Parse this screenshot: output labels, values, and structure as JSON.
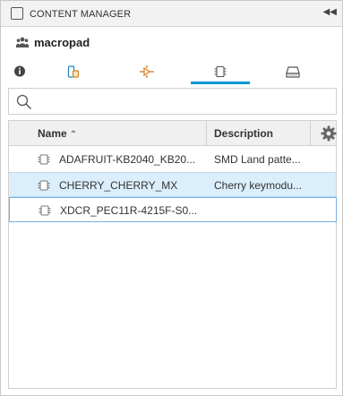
{
  "panel": {
    "title": "CONTENT MANAGER",
    "collapse_icon": "double-chevron-left-icon"
  },
  "project": {
    "name": "macropad",
    "icon": "people-group-icon"
  },
  "tabs": [
    {
      "icon": "info-icon",
      "active": false
    },
    {
      "icon": "component-icon",
      "active": false
    },
    {
      "icon": "symbol-icon",
      "active": false
    },
    {
      "icon": "footprint-icon",
      "active": true
    },
    {
      "icon": "3d-package-icon",
      "active": false
    }
  ],
  "search": {
    "value": "",
    "placeholder": "",
    "icon": "search-icon"
  },
  "table": {
    "columns": {
      "name": "Name",
      "description": "Description",
      "sort": "ascending",
      "settings_icon": "gear-icon"
    },
    "rows": [
      {
        "name": "ADAFRUIT-KB2040_KB20...",
        "description": "SMD Land patte...",
        "icon": "footprint-icon",
        "state": "normal"
      },
      {
        "name": "CHERRY_CHERRY_MX",
        "description": "Cherry keymodu...",
        "icon": "footprint-icon",
        "state": "selected"
      },
      {
        "name": "XDCR_PEC11R-4215F-S0...",
        "description": "",
        "icon": "footprint-icon",
        "state": "focused"
      }
    ]
  },
  "colors": {
    "accent": "#0696d7",
    "selected_row": "#dbeefb",
    "footprint_orange": "#d9822b"
  }
}
